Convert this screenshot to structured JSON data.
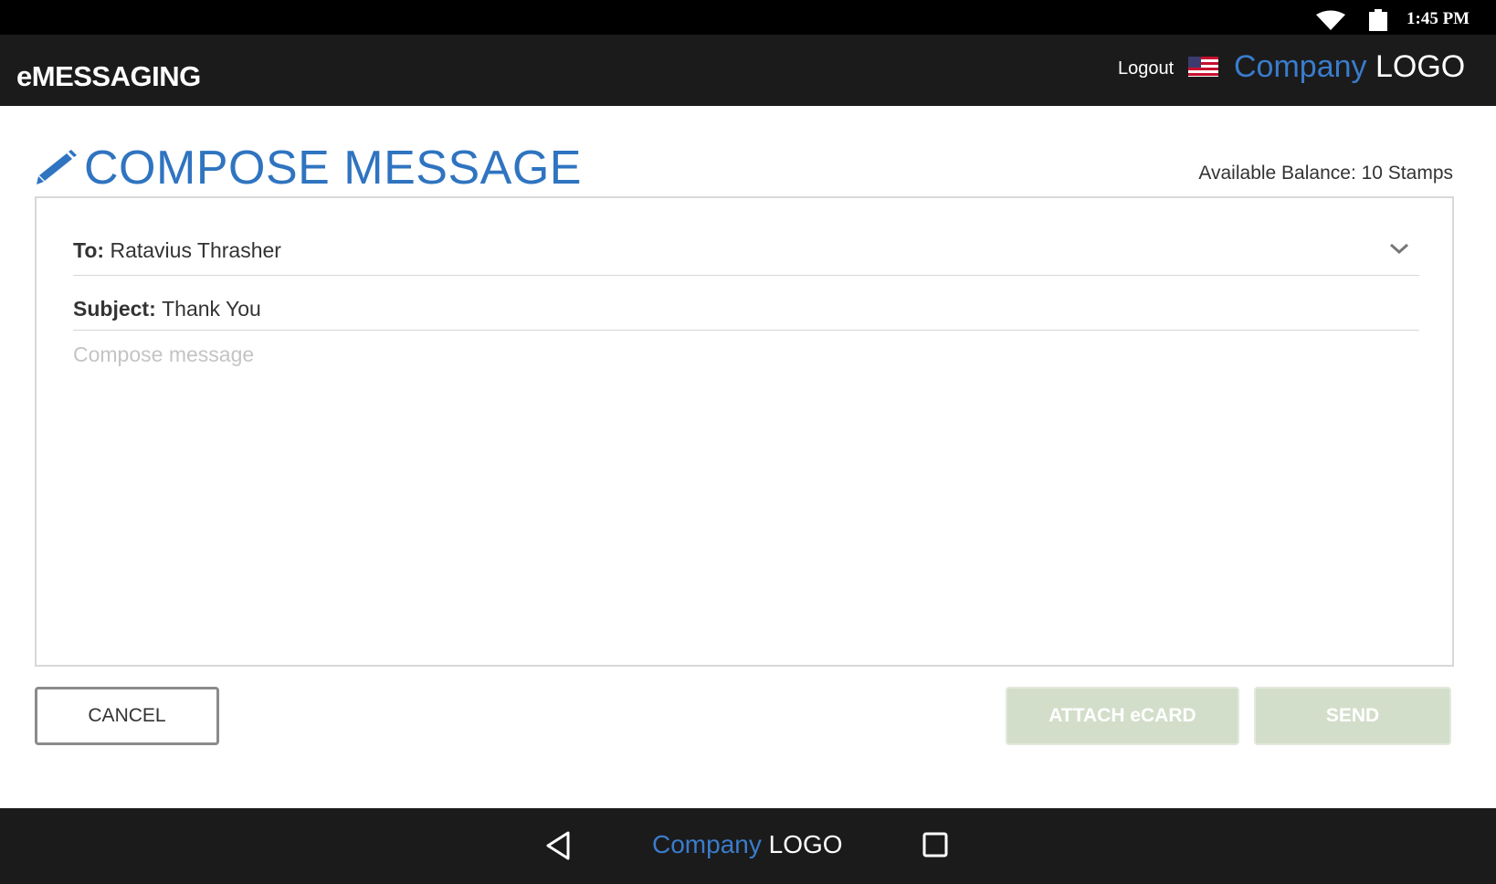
{
  "status_bar": {
    "time": "1:45 PM",
    "icons": [
      "wifi-icon",
      "battery-icon"
    ]
  },
  "app_header": {
    "title": "eMESSAGING",
    "logout_label": "Logout",
    "flag_icon": "us-flag-icon",
    "logo": {
      "company": "Company",
      "suffix": "LOGO"
    }
  },
  "page": {
    "title": "COMPOSE MESSAGE",
    "title_icon": "pencil-icon",
    "balance_text": "Available Balance: 10 Stamps"
  },
  "compose": {
    "to_label": "To:",
    "to_value": "Ratavius Thrasher",
    "subject_label": "Subject:",
    "subject_value": "Thank You",
    "message_placeholder": "Compose message",
    "message_value": ""
  },
  "actions": {
    "cancel_label": "CANCEL",
    "attach_label": "ATTACH eCARD",
    "send_label": "SEND"
  },
  "nav_bar": {
    "logo": {
      "company": "Company",
      "suffix": "LOGO"
    },
    "icons": [
      "back-icon",
      "recents-icon"
    ]
  },
  "colors": {
    "accent_blue": "#2f74c0",
    "logo_blue": "#3a7ccc",
    "header_bg": "#1b1b1b",
    "disabled_button_bg": "#d3deca"
  }
}
